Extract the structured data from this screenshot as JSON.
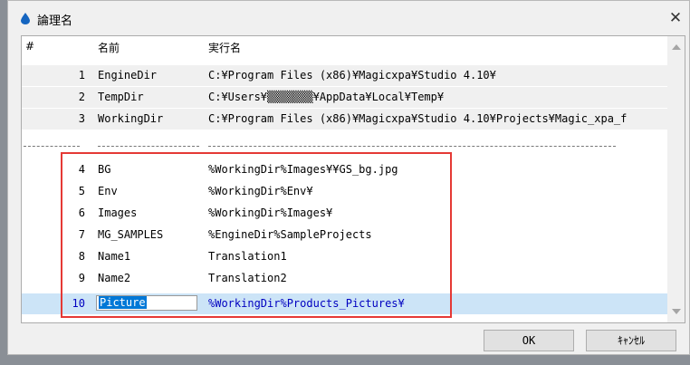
{
  "window": {
    "title": "論理名",
    "close_glyph": "✕"
  },
  "columns": {
    "num": "#",
    "name": "名前",
    "value": "実行名"
  },
  "system_rows": [
    {
      "num": "1",
      "name": "EngineDir",
      "value": "C:¥Program Files (x86)¥Magicxpa¥Studio 4.10¥"
    },
    {
      "num": "2",
      "name": "TempDir",
      "value": "C:¥Users¥▒▒▒▒▒▒▒¥AppData¥Local¥Temp¥"
    },
    {
      "num": "3",
      "name": "WorkingDir",
      "value": "C:¥Program Files (x86)¥Magicxpa¥Studio 4.10¥Projects¥Magic_xpa_f"
    }
  ],
  "user_rows": [
    {
      "num": "4",
      "name": "BG",
      "value": "%WorkingDir%Images¥¥GS_bg.jpg"
    },
    {
      "num": "5",
      "name": "Env",
      "value": "%WorkingDir%Env¥"
    },
    {
      "num": "6",
      "name": "Images",
      "value": "%WorkingDir%Images¥"
    },
    {
      "num": "7",
      "name": "MG_SAMPLES",
      "value": "%EngineDir%SampleProjects"
    },
    {
      "num": "8",
      "name": "Name1",
      "value": "Translation1"
    },
    {
      "num": "9",
      "name": "Name2",
      "value": "Translation2"
    }
  ],
  "selected_row": {
    "num": "10",
    "name": "Picture",
    "value": "%WorkingDir%Products_Pictures¥"
  },
  "buttons": {
    "ok": "OK",
    "cancel": "ｷｬﾝｾﾙ"
  },
  "colors": {
    "selection": "#cce4f7",
    "highlight_box": "#e53935",
    "app_icon": "#1565c0"
  }
}
